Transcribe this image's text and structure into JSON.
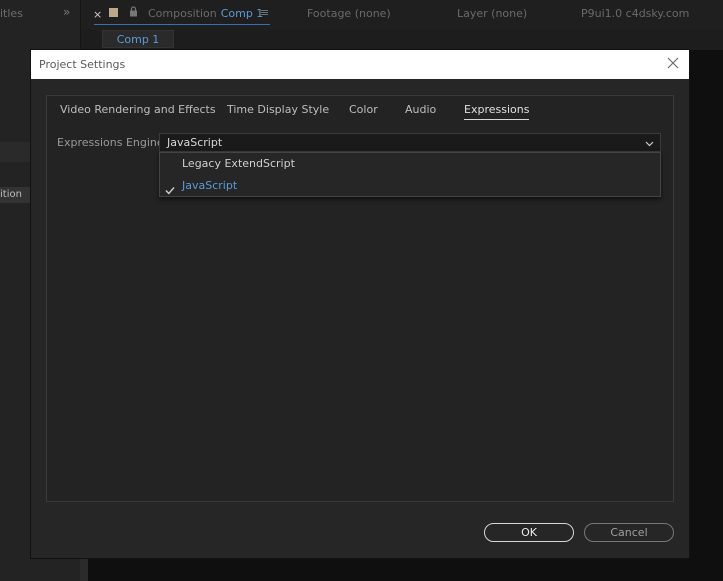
{
  "background": {
    "left_panel_title_fragment": "itles",
    "left_panel_row_fragment": "ition",
    "comp_tab": {
      "close": "×",
      "label": "Composition",
      "name": "Comp 1",
      "menu": "≡"
    },
    "footage_tab": "Footage (none)",
    "layer_tab": "Layer (none)",
    "watermark": "P9ui1.0 c4dsky.com",
    "sub_tab": "Comp 1",
    "chevron": "»"
  },
  "dialog": {
    "title": "Project Settings",
    "tabs": [
      {
        "label": "Video Rendering and Effects",
        "active": false
      },
      {
        "label": "Time Display Style",
        "active": false
      },
      {
        "label": "Color",
        "active": false
      },
      {
        "label": "Audio",
        "active": false
      },
      {
        "label": "Expressions",
        "active": true
      }
    ],
    "expressions_engine": {
      "label": "Expressions Engine:",
      "selected": "JavaScript",
      "options": [
        {
          "label": "Legacy ExtendScript",
          "checked": false
        },
        {
          "label": "JavaScript",
          "checked": true
        }
      ]
    },
    "ok_label": "OK",
    "cancel_label": "Cancel"
  },
  "colors": {
    "accent": "#5b9bd5",
    "dialog_bg": "#262626",
    "titlebar_bg": "#ffffff"
  }
}
